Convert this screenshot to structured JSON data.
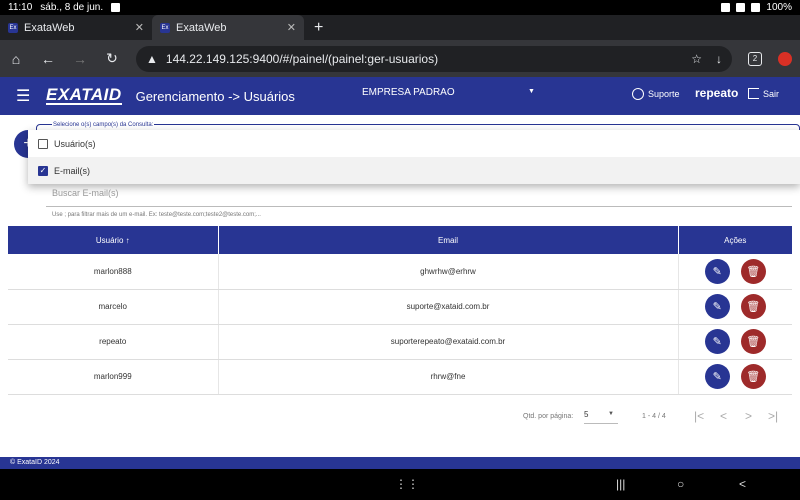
{
  "status_bar": {
    "time": "11:10",
    "date": "sáb., 8 de jun.",
    "battery": "100%"
  },
  "browser": {
    "tabs": [
      {
        "label": "ExataWeb",
        "favicon": "Ex"
      },
      {
        "label": "ExataWeb",
        "favicon": "Ex"
      }
    ],
    "url": "144.22.149.125:9400/#/painel/(painel:ger-usuarios)",
    "tab_count": "2"
  },
  "header": {
    "logo_text": "EXATA",
    "logo_suffix": "ID",
    "title": "Gerenciamento -> Usuários",
    "company": "EMPRESA PADRAO",
    "support_label": "Suporte",
    "username": "repeato",
    "logout_label": "Sair"
  },
  "search": {
    "field_label": "Selecione o(s) campo(s) da Consulta:",
    "options": [
      {
        "label": "Usuário(s)",
        "checked": false
      },
      {
        "label": "E-mail(s)",
        "checked": true
      }
    ],
    "placeholder": "Buscar E-mail(s)",
    "hint": "Use ; para filtrar mais de um e-mail. Ex: teste@teste.com;teste2@teste.com;..."
  },
  "table": {
    "headers": {
      "user": "Usuário",
      "email": "Email",
      "actions": "Ações"
    },
    "rows": [
      {
        "user": "marlon888",
        "email": "ghwrhw@erhrw"
      },
      {
        "user": "marcelo",
        "email": "suporte@xataid.com.br"
      },
      {
        "user": "repeato",
        "email": "suporterepeato@exataid.com.br"
      },
      {
        "user": "marlon999",
        "email": "rhrw@fne"
      }
    ]
  },
  "pagination": {
    "label": "Qtd. por página:",
    "page_size": "5",
    "range": "1 - 4 / 4"
  },
  "footer": {
    "text": "© ExataID 2024"
  },
  "colors": {
    "primary": "#283593",
    "danger": "#9e2a2a"
  }
}
